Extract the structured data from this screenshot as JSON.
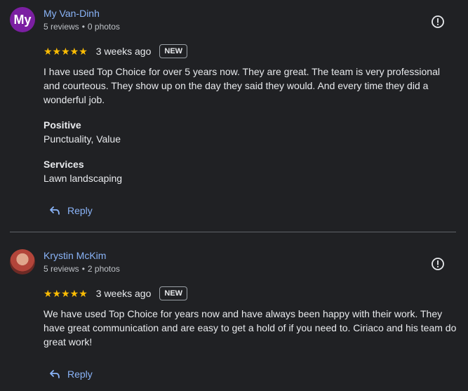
{
  "reviews": [
    {
      "avatar_text": "My",
      "avatar_color": "#7b1fa2",
      "name": "My Van-Dinh",
      "review_count": "5 reviews",
      "photo_count": "0 photos",
      "stars": "★★★★★",
      "rating": 5,
      "time": "3 weeks ago",
      "badge": "NEW",
      "text": "I have used Top Choice for over 5 years now. They are great. The team is very professional and courteous. They show up on the day they said they would. And every time they did a wonderful job.",
      "attributes": [
        {
          "title": "Positive",
          "value": "Punctuality, Value"
        },
        {
          "title": "Services",
          "value": "Lawn landscaping"
        }
      ],
      "reply_label": "Reply"
    },
    {
      "avatar_text": "",
      "name": "Krystin McKim",
      "review_count": "5 reviews",
      "photo_count": "2 photos",
      "stars": "★★★★★",
      "rating": 5,
      "time": "3 weeks ago",
      "badge": "NEW",
      "text": "We have used Top Choice for years now and have always been happy with their work. They have great communication and are easy to get a hold of if you need to. Ciriaco and his team do great work!",
      "reply_label": "Reply"
    }
  ],
  "separator": "•",
  "colors": {
    "background": "#202124",
    "link": "#8ab4f8",
    "star": "#fbbc04"
  }
}
